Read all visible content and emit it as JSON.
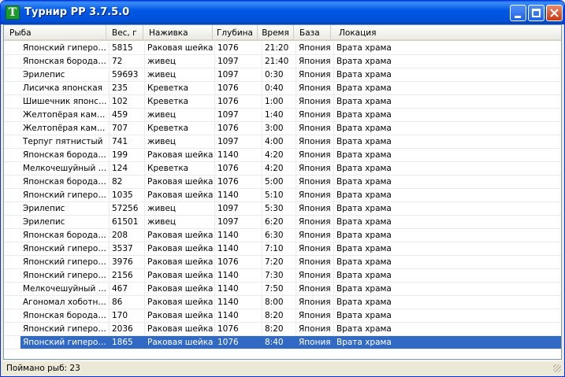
{
  "window": {
    "title": "Турнир РР 3.7.5.0",
    "app_icon_glyph": "T"
  },
  "columns": [
    "Рыба",
    "Вес, г",
    "Наживка",
    "Глубина",
    "Время",
    "База",
    "Локация"
  ],
  "rows": [
    [
      "Японский гиперог...",
      "5815",
      "Раковая шейка",
      "1076",
      "21:20",
      "Япония",
      "Врата храма"
    ],
    [
      "Японская бородав...",
      "72",
      "живец",
      "1097",
      "21:40",
      "Япония",
      "Врата храма"
    ],
    [
      "Эрилепис",
      "59693",
      "живец",
      "1097",
      "0:30",
      "Япония",
      "Врата храма"
    ],
    [
      "Лисичка японская",
      "235",
      "Креветка",
      "1076",
      "0:40",
      "Япония",
      "Врата храма"
    ],
    [
      "Шишечник японский",
      "102",
      "Креветка",
      "1076",
      "1:00",
      "Япония",
      "Врата храма"
    ],
    [
      "Желтопёрая камб...",
      "459",
      "живец",
      "1097",
      "1:40",
      "Япония",
      "Врата храма"
    ],
    [
      "Желтопёрая камб...",
      "707",
      "Креветка",
      "1076",
      "3:00",
      "Япония",
      "Врата храма"
    ],
    [
      "Терпуг пятнистый",
      "741",
      "живец",
      "1097",
      "4:00",
      "Япония",
      "Врата храма"
    ],
    [
      "Японская бородав...",
      "199",
      "Раковая шейка",
      "1140",
      "4:20",
      "Япония",
      "Врата храма"
    ],
    [
      "Мелкочешуйный у...",
      "124",
      "Креветка",
      "1076",
      "4:20",
      "Япония",
      "Врата храма"
    ],
    [
      "Японская бородав...",
      "82",
      "Раковая шейка",
      "1076",
      "5:00",
      "Япония",
      "Врата храма"
    ],
    [
      "Японский гиперог...",
      "1035",
      "Раковая шейка",
      "1140",
      "5:10",
      "Япония",
      "Врата храма"
    ],
    [
      "Эрилепис",
      "57256",
      "живец",
      "1097",
      "5:30",
      "Япония",
      "Врата храма"
    ],
    [
      "Эрилепис",
      "61501",
      "живец",
      "1097",
      "6:20",
      "Япония",
      "Врата храма"
    ],
    [
      "Японская бородав...",
      "208",
      "Раковая шейка",
      "1140",
      "6:30",
      "Япония",
      "Врата храма"
    ],
    [
      "Японский гиперог...",
      "3537",
      "Раковая шейка",
      "1140",
      "7:10",
      "Япония",
      "Врата храма"
    ],
    [
      "Японский гиперог...",
      "3976",
      "Раковая шейка",
      "1076",
      "7:20",
      "Япония",
      "Врата храма"
    ],
    [
      "Японский гиперог...",
      "2156",
      "Раковая шейка",
      "1140",
      "7:30",
      "Япония",
      "Врата храма"
    ],
    [
      "Мелкочешуйный у...",
      "467",
      "Раковая шейка",
      "1140",
      "7:50",
      "Япония",
      "Врата храма"
    ],
    [
      "Агономал хоботный",
      "86",
      "Раковая шейка",
      "1140",
      "8:00",
      "Япония",
      "Врата храма"
    ],
    [
      "Японская бородав...",
      "170",
      "Раковая шейка",
      "1140",
      "8:20",
      "Япония",
      "Врата храма"
    ],
    [
      "Японский гиперог...",
      "2036",
      "Раковая шейка",
      "1076",
      "8:20",
      "Япония",
      "Врата храма"
    ],
    [
      "Японский гиперог...",
      "1865",
      "Раковая шейка",
      "1076",
      "8:40",
      "Япония",
      "Врата храма"
    ]
  ],
  "selected_row": 22,
  "status": {
    "text": "Поймано рыб: 23"
  },
  "colors": {
    "titlebar": "#0058e6",
    "selection": "#316ac5",
    "window_face": "#ece9d8"
  }
}
